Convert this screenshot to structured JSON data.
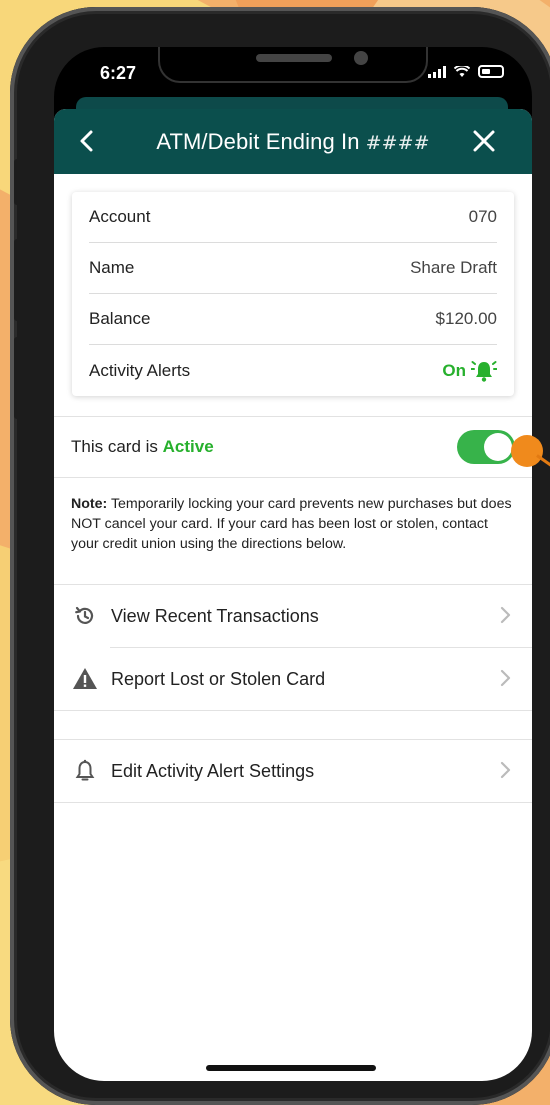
{
  "status_bar": {
    "time": "6:27"
  },
  "header": {
    "title": "ATM/Debit Ending In",
    "masked_number": "####"
  },
  "account_card": {
    "rows": [
      {
        "label": "Account",
        "value": "070"
      },
      {
        "label": "Name",
        "value": "Share Draft"
      },
      {
        "label": "Balance",
        "value": "$120.00"
      }
    ],
    "alerts": {
      "label": "Activity Alerts",
      "value": "On"
    }
  },
  "card_status": {
    "prefix": "This card is",
    "state": "Active",
    "toggle_on": true
  },
  "note": {
    "lead": "Note:",
    "text": " Temporarily locking your card prevents new purchases but does NOT cancel your card. If your card has been lost or stolen, contact your credit union using the directions below."
  },
  "menu": {
    "recent": "View Recent Transactions",
    "lost": "Report Lost or Stolen Card",
    "alerts": "Edit Activity Alert Settings"
  },
  "colors": {
    "header": "#0b4f4d",
    "accent_green": "#27b02d",
    "toggle": "#37b34a",
    "pointer": "#f08a1c"
  },
  "icons": [
    "back-icon",
    "close-icon",
    "bell-ringing-icon",
    "history-icon",
    "warning-icon",
    "bell-icon",
    "chevron-right-icon"
  ]
}
